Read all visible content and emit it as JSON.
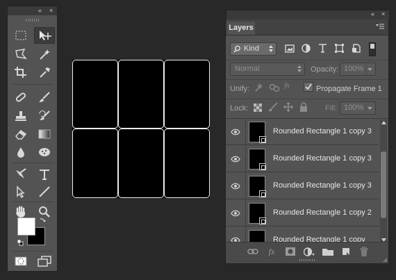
{
  "tools_panel": {
    "collapse_glyph": "«",
    "close_glyph": "×",
    "tool_icons": [
      "rectangular-marquee-icon",
      "move-tool-icon",
      "polygonal-lasso-icon",
      "magic-wand-icon",
      "crop-tool-icon",
      "eyedropper-icon",
      "spot-healing-brush-icon",
      "brush-tool-icon",
      "clone-stamp-icon",
      "history-brush-icon",
      "eraser-icon",
      "gradient-icon",
      "blur-drop-icon",
      "sponge-icon",
      "pen-tool-icon",
      "type-tool-icon",
      "path-selection-icon",
      "line-tool-icon",
      "hand-tool-icon",
      "zoom-tool-icon"
    ],
    "foreground_color": "#ffffff",
    "background_color": "#000000"
  },
  "canvas": {
    "fill": "#000000",
    "stroke": "#ededed",
    "grid": {
      "columns": 3,
      "rows": 2
    }
  },
  "layers_panel": {
    "collapse_glyph": "«",
    "close_glyph": "×",
    "tab_label": "Layers",
    "filter": {
      "kind_label": "Kind",
      "search_icon": "search-icon"
    },
    "blend_mode": "Normal",
    "opacity_label": "Opacity:",
    "opacity_value": "100%",
    "unify_label": "Unify:",
    "propagate_label": "Propagate Frame 1",
    "lock_label": "Lock:",
    "fill_label": "Fill:",
    "fill_value": "100%",
    "layers": [
      {
        "name": "Rounded Rectangle 1 copy 3"
      },
      {
        "name": "Rounded Rectangle 1 copy 3"
      },
      {
        "name": "Rounded Rectangle 1 copy 3"
      },
      {
        "name": "Rounded Rectangle 1 copy 2"
      },
      {
        "name": "Rounded Rectangle 1 copy"
      }
    ],
    "footer_icons": [
      "link-layers-icon",
      "fx-icon",
      "add-mask-icon",
      "adjustment-layer-icon",
      "new-group-icon",
      "new-layer-icon",
      "trash-icon"
    ],
    "fx_glyph": "fx"
  }
}
